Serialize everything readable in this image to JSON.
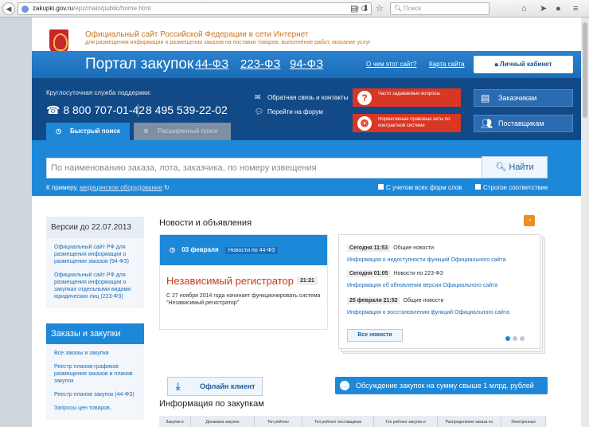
{
  "browser": {
    "url_host": "zakupki.gov.ru",
    "url_path": "/epz/main/public/home.html",
    "search_placeholder": "Поиск"
  },
  "header": {
    "site_title": "Официальный сайт Российской Федерации в сети Интернет",
    "site_subtitle": "для размещения информации о размещении заказов на поставки товаров, выполнение работ, оказание услуг",
    "portal_title": "Портал закупок",
    "law_links": [
      "44-ФЗ",
      "223-ФЗ",
      "94-ФЗ"
    ],
    "about_link": "О чем этот сайт?",
    "sitemap_link": "Карта сайта",
    "cabinet_button": "Личный кабинет"
  },
  "support": {
    "label": "Круглосуточная служба поддержки:",
    "phone1": "8 800 707-01-42",
    "phone2": "8 495 539-22-02",
    "feedback_link": "Обратная связь и контакты",
    "forum_link": "Перейти на форум",
    "faq_button": "Часто задаваемые вопросы",
    "legal_button": "Нормативные правовые акты по контрактной системе",
    "customers_button": "Заказчикам",
    "suppliers_button": "Поставщикам"
  },
  "search": {
    "tab_quick": "Быстрый поиск",
    "tab_advanced": "Расширенный поиск",
    "placeholder": "По наименованию заказа, лота, заказчика, по номеру извещения",
    "find_button": "Найти",
    "example_prefix": "К примеру,",
    "example_link": "медицинское оборудование",
    "option_all_forms": "С учетом всех форм слов",
    "option_strict": "Строгое соответствие"
  },
  "sidebar": {
    "versions_title": "Версии до 22.07.2013",
    "versions": [
      "Официальный сайт РФ для размещения информации о размещении заказов (94-ФЗ)",
      "Официальный сайт РФ для размещения информации о закупках отдельными видами юридических лиц (223-ФЗ)"
    ],
    "orders_title": "Заказы и закупки",
    "orders": [
      "Все заказы и закупки",
      "Реестр планов-графиков размещения заказов и планов закупок",
      "Реестр планов закупок (44-ФЗ)",
      "Запросы цен товаров,"
    ]
  },
  "news": {
    "title": "Новости и объявления",
    "card_date": "03 февраля",
    "card_tag": "Новости по 44-ФЗ",
    "card_headline": "Независимый регистратор",
    "card_time": "21:21",
    "card_text": "С 27 ноября 2014 года начинает функционировать система \"Независимый регистратор\"",
    "feed": [
      {
        "when": "Сегодня 11:53",
        "category": "Общие новости",
        "text": "Информация о недоступности функций Официального сайта"
      },
      {
        "when": "Сегодня 01:05",
        "category": "Новости по 223-ФЗ",
        "text": "Информация об обновлении версии Официального сайта"
      },
      {
        "when": "25 февраля 21:52",
        "category": "Общие новости",
        "text": "Информация о восстановлении функций Официального сайта"
      }
    ],
    "all_news_button": "Все новости"
  },
  "actions": {
    "offline_client": "Офлайн клиент",
    "discussion": "Обсуждение закупок на сумму свыше 1 млрд. рублей"
  },
  "info": {
    "title": "Информация по закупкам",
    "tabs": [
      "Закупки в",
      "Динамика закупок",
      "Топ рейтинг",
      "Топ рейтинг поставщиков",
      "Топ рейтинг закупок и",
      "Распределение заказа по",
      "Электронные"
    ]
  }
}
